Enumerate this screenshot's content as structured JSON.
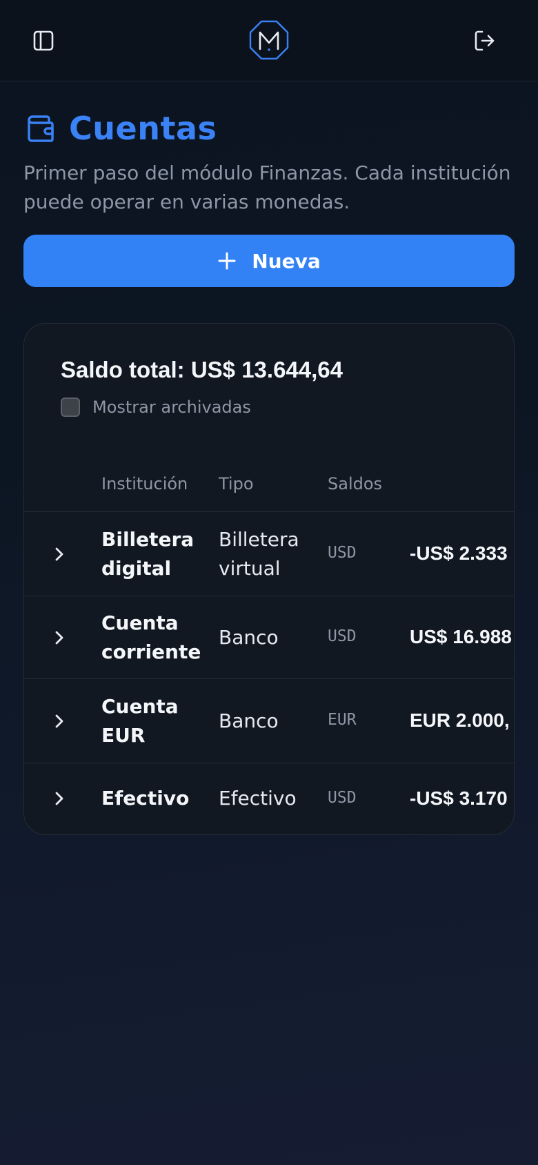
{
  "header": {
    "sidebar_toggle_icon": "sidebar-panel-icon",
    "logo_icon": "octagon-m-logo",
    "logout_icon": "logout-icon"
  },
  "page": {
    "title": "Cuentas",
    "title_icon": "wallet-icon",
    "subtitle": "Primer paso del módulo Finanzas. Cada institución puede operar en varias monedas.",
    "new_button_label": "Nueva",
    "new_button_icon": "plus-icon"
  },
  "summary": {
    "total_label": "Saldo total: US$ 13.644,64",
    "show_archived_label": "Mostrar archivadas",
    "show_archived_checked": false
  },
  "table": {
    "headers": {
      "institution": "Institución",
      "type": "Tipo",
      "balances": "Saldos"
    },
    "rows": [
      {
        "institution": "Billetera digital",
        "type": "Billetera virtual",
        "currency": "USD",
        "amount": "-US$ 2.333"
      },
      {
        "institution": "Cuenta corriente",
        "type": "Banco",
        "currency": "USD",
        "amount": "US$ 16.988"
      },
      {
        "institution": "Cuenta EUR",
        "type": "Banco",
        "currency": "EUR",
        "amount": "EUR 2.000,"
      },
      {
        "institution": "Efectivo",
        "type": "Efectivo",
        "currency": "USD",
        "amount": "-US$ 3.170"
      }
    ]
  },
  "colors": {
    "accent": "#3b82f6",
    "button": "#3382f5",
    "background": "#0b1420",
    "card": "#121821",
    "muted_text": "#8d97a6"
  }
}
